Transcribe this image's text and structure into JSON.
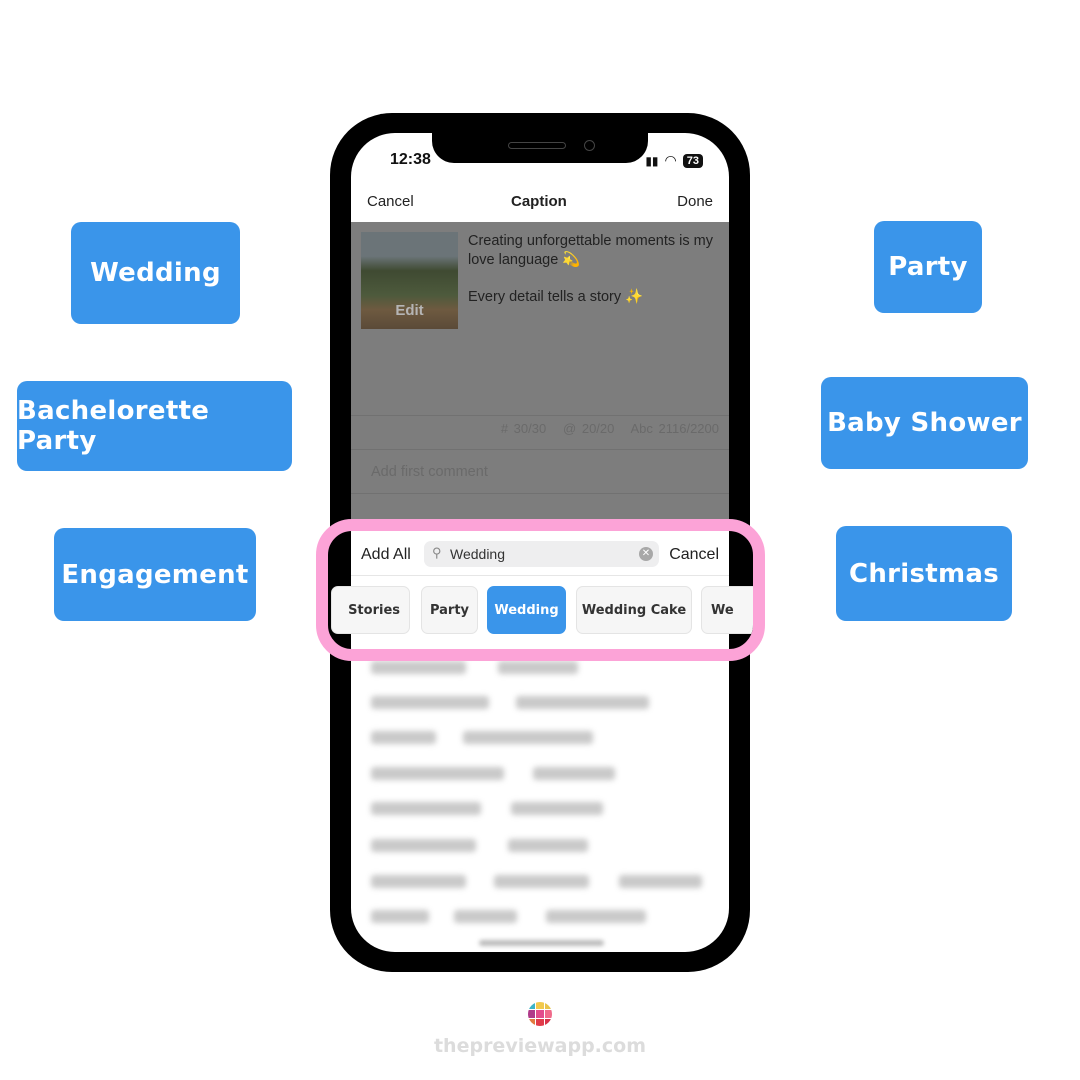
{
  "tags_left": [
    "Wedding",
    "Bachelorette Party",
    "Engagement"
  ],
  "tags_right": [
    "Party",
    "Baby Shower",
    "Christmas"
  ],
  "status_bar": {
    "time": "12:38",
    "battery": "73"
  },
  "nav": {
    "cancel": "Cancel",
    "title": "Caption",
    "done": "Done"
  },
  "post": {
    "edit_label": "Edit",
    "caption_line1": "Creating unforgettable moments is my love language 💫",
    "caption_line2": "Every detail tells a story ✨",
    "hashtag_count": "# 30/30",
    "mention_count": "@ 20/20",
    "char_count": "Abc 2116/2200",
    "comment_placeholder": "Add first comment"
  },
  "hashtag_search": {
    "add_all": "Add All",
    "query": "Wedding",
    "cancel": "Cancel",
    "chips": [
      "Stories",
      "Party",
      "Wedding",
      "Wedding Cake",
      "We"
    ],
    "active_chip": "Wedding"
  },
  "footer": {
    "site": "thepreviewapp.com"
  },
  "colors": {
    "tag_blue": "#3a95ea",
    "highlight_pink": "#fca3d7",
    "logo": [
      "#3bb4c8",
      "#f2c94c",
      "#e8c34a",
      "#b03a8a",
      "#e24c8c",
      "#f06a8a",
      "#e27a40",
      "#e03a4a",
      "#d8324a"
    ]
  }
}
